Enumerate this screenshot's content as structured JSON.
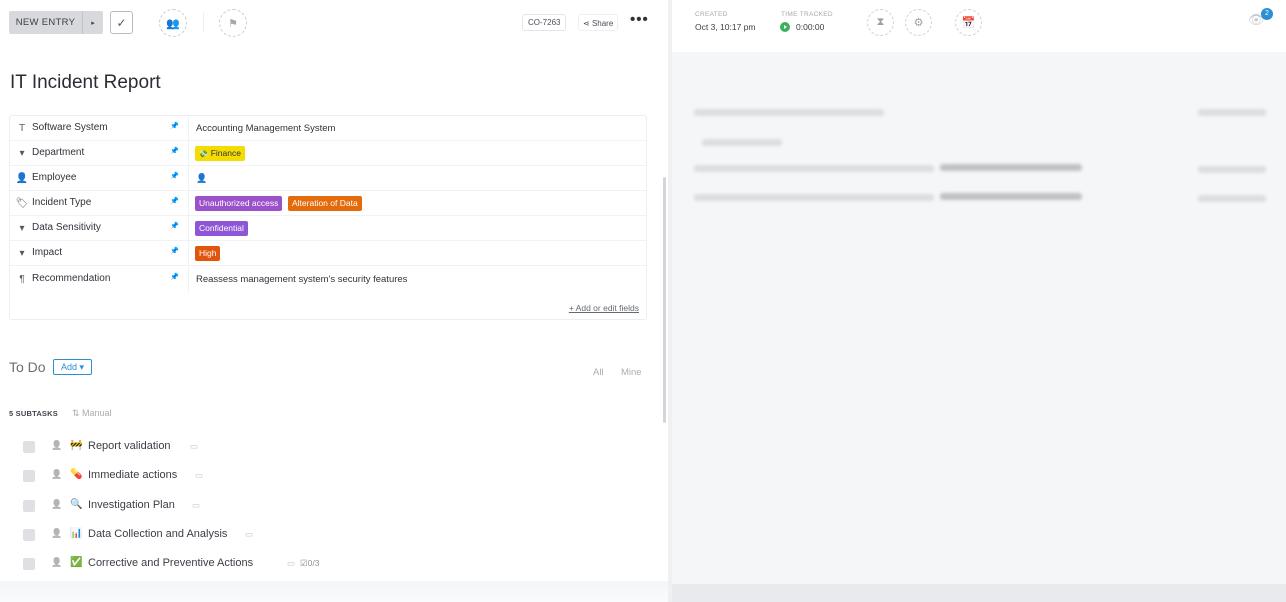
{
  "toolbar": {
    "new_entry_label": "NEW ENTRY",
    "split_arrow": "▸",
    "check_glyph": "✓",
    "task_id": "CO-7263",
    "share_label": "Share",
    "more_glyph": "•••"
  },
  "task": {
    "title": "IT Incident Report"
  },
  "fields": [
    {
      "icon": "text-type-icon",
      "glyph": "T",
      "name": "Software System",
      "value": "Accounting Management System"
    },
    {
      "icon": "dropdown-icon",
      "glyph": "▾",
      "name": "Department",
      "tag": {
        "label": "Finance",
        "bg": "#f5dc00",
        "fg": "#2f333a",
        "glyph": "💸"
      }
    },
    {
      "icon": "person-icon",
      "glyph": "👤",
      "name": "Employee",
      "assignee_placeholder": true
    },
    {
      "icon": "tag-icon",
      "glyph": "🏷",
      "name": "Incident Type",
      "tags": [
        {
          "label": "Unauthorized access",
          "bg": "#9b51c9",
          "fg": "#ffffff"
        },
        {
          "label": "Alteration of Data",
          "bg": "#e36b0c",
          "fg": "#ffffff"
        }
      ]
    },
    {
      "icon": "dropdown-icon",
      "glyph": "▾",
      "name": "Data Sensitivity",
      "tag": {
        "label": "Confidential",
        "bg": "#8e55d6",
        "fg": "#ffffff"
      }
    },
    {
      "icon": "dropdown-icon",
      "glyph": "▾",
      "name": "Impact",
      "tag": {
        "label": "High",
        "bg": "#e1550f",
        "fg": "#ffffff"
      }
    },
    {
      "icon": "long-text-icon",
      "glyph": "¶",
      "name": "Recommendation",
      "value": "Reassess management system's security features"
    }
  ],
  "add_edit_label": "+ Add or edit fields",
  "todo": {
    "title": "To Do",
    "add_label": "Add ▾",
    "filter_all": "All",
    "filter_mine": "Mine",
    "subtasks_count_label": "5 SUBTASKS",
    "sort_label": "Manual"
  },
  "subtasks": [
    {
      "emoji": "🚧",
      "name": "Report validation",
      "extra": ""
    },
    {
      "emoji": "💊",
      "name": "Immediate actions",
      "extra": ""
    },
    {
      "emoji": "🔍",
      "name": "Investigation Plan",
      "extra": ""
    },
    {
      "emoji": "📊",
      "name": "Data Collection and Analysis",
      "extra": ""
    },
    {
      "emoji": "✅",
      "name": "Corrective and Preventive Actions",
      "extra": "☑0/3"
    }
  ],
  "right": {
    "created_label": "CREATED",
    "created_value": "Oct 3, 10:17 pm",
    "time_label": "TIME TRACKED",
    "time_value": "0:00:00",
    "watchers_count": "2"
  },
  "colors": {
    "accent": "#2b8fd6",
    "timer_green": "#3db05f"
  }
}
